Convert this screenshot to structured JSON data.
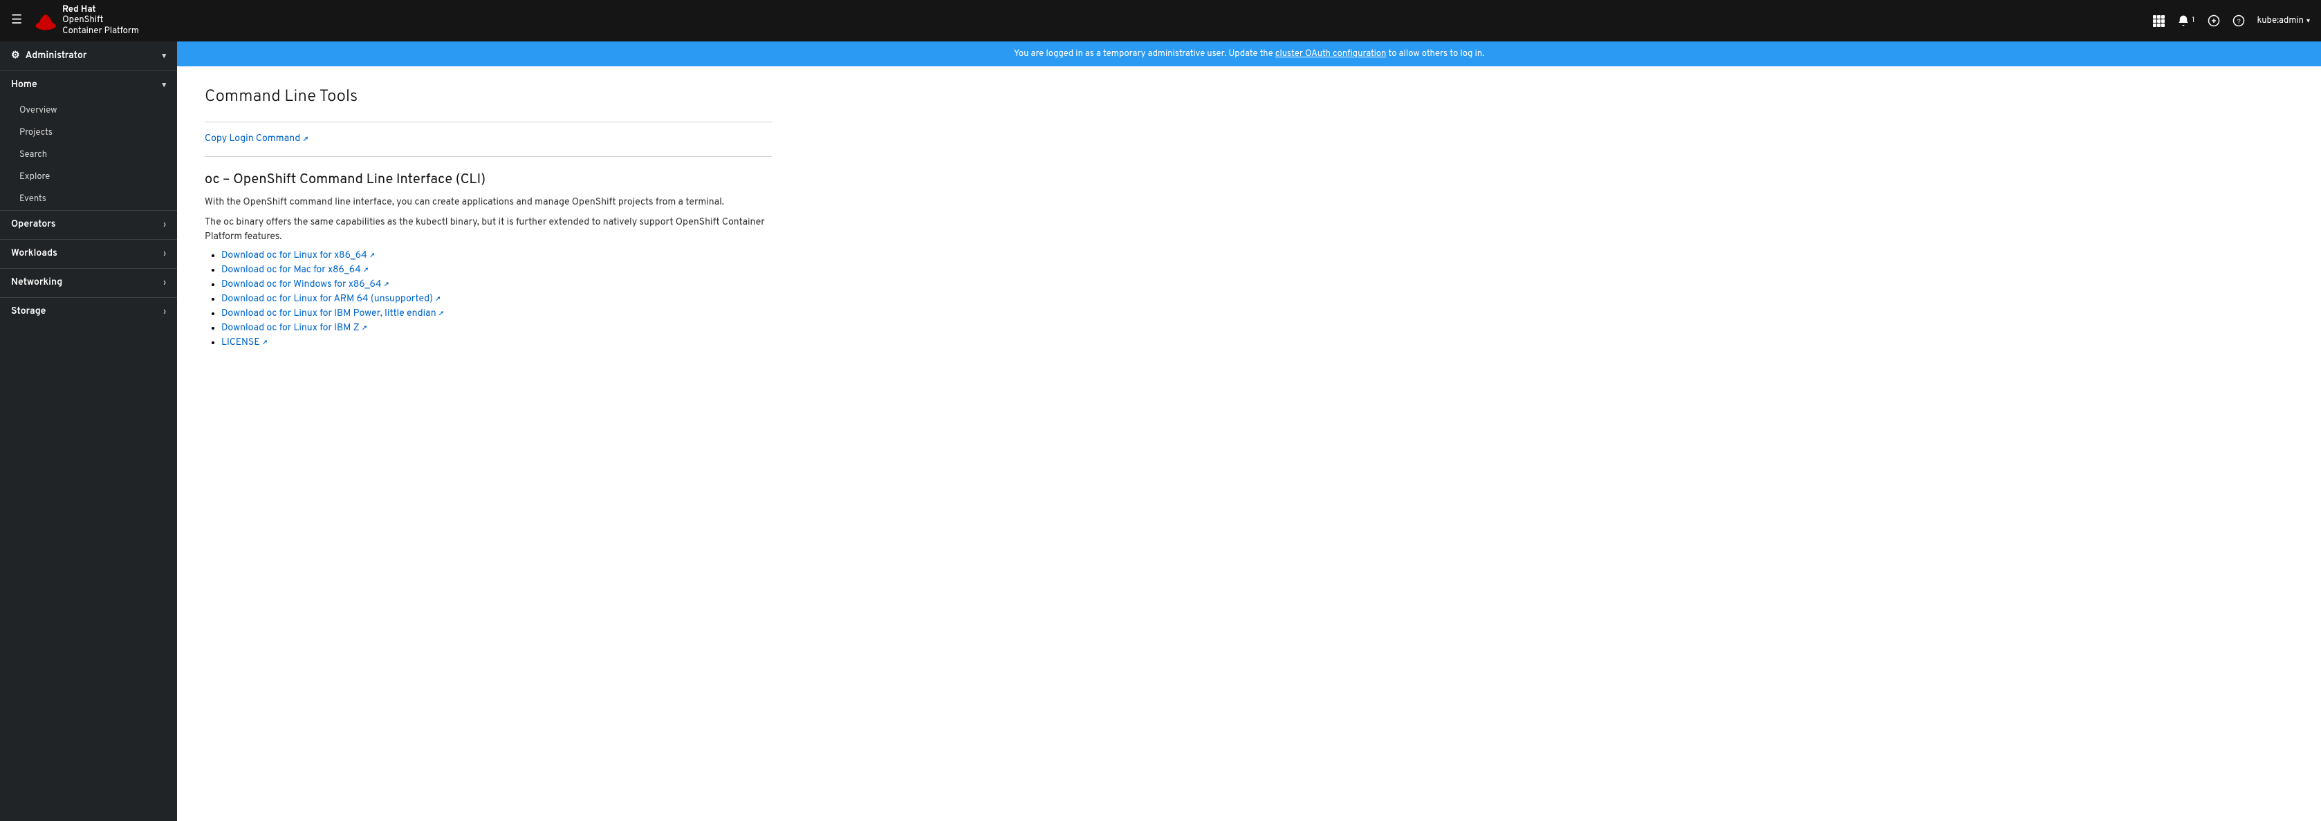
{
  "topnav": {
    "hamburger_label": "☰",
    "brand_redhat": "Red Hat",
    "brand_product": "OpenShift",
    "brand_platform": "Container Platform",
    "apps_icon": "⊞",
    "bell_icon": "🔔",
    "bell_count": "1",
    "plus_icon": "+",
    "help_icon": "?",
    "user_label": "kube:admin",
    "user_caret": "▾"
  },
  "banner": {
    "text": "You are logged in as a temporary administrative user. Update the ",
    "link_text": "cluster OAuth configuration",
    "text_after": " to allow others to log in."
  },
  "sidebar": {
    "administrator_label": "Administrator",
    "administrator_caret": "▾",
    "home_label": "Home",
    "home_caret": "▾",
    "nav_items": [
      {
        "label": "Overview",
        "name": "overview"
      },
      {
        "label": "Projects",
        "name": "projects"
      },
      {
        "label": "Search",
        "name": "search"
      },
      {
        "label": "Explore",
        "name": "explore"
      },
      {
        "label": "Events",
        "name": "events"
      }
    ],
    "operators_label": "Operators",
    "operators_caret": "›",
    "workloads_label": "Workloads",
    "workloads_caret": "›",
    "networking_label": "Networking",
    "networking_caret": "›",
    "storage_label": "Storage",
    "storage_caret": "›"
  },
  "main": {
    "page_title": "Command Line Tools",
    "copy_login_link": "Copy Login Command",
    "oc_section_title": "oc – OpenShift Command Line Interface (CLI)",
    "oc_desc_1": "With the OpenShift command line interface, you can create applications and manage OpenShift projects from a terminal.",
    "oc_desc_2": "The oc binary offers the same capabilities as the kubectl binary, but it is further extended to natively support OpenShift Container Platform features.",
    "download_links": [
      {
        "label": "Download oc for Linux for x86_64",
        "name": "dl-linux-x86"
      },
      {
        "label": "Download oc for Mac for x86_64",
        "name": "dl-mac-x86"
      },
      {
        "label": "Download oc for Windows for x86_64",
        "name": "dl-windows-x86"
      },
      {
        "label": "Download oc for Linux for ARM 64 (unsupported)",
        "name": "dl-linux-arm64"
      },
      {
        "label": "Download oc for Linux for IBM Power, little endian",
        "name": "dl-linux-ibm-power"
      },
      {
        "label": "Download oc for Linux for IBM Z",
        "name": "dl-linux-ibm-z"
      },
      {
        "label": "LICENSE",
        "name": "dl-license"
      }
    ]
  }
}
